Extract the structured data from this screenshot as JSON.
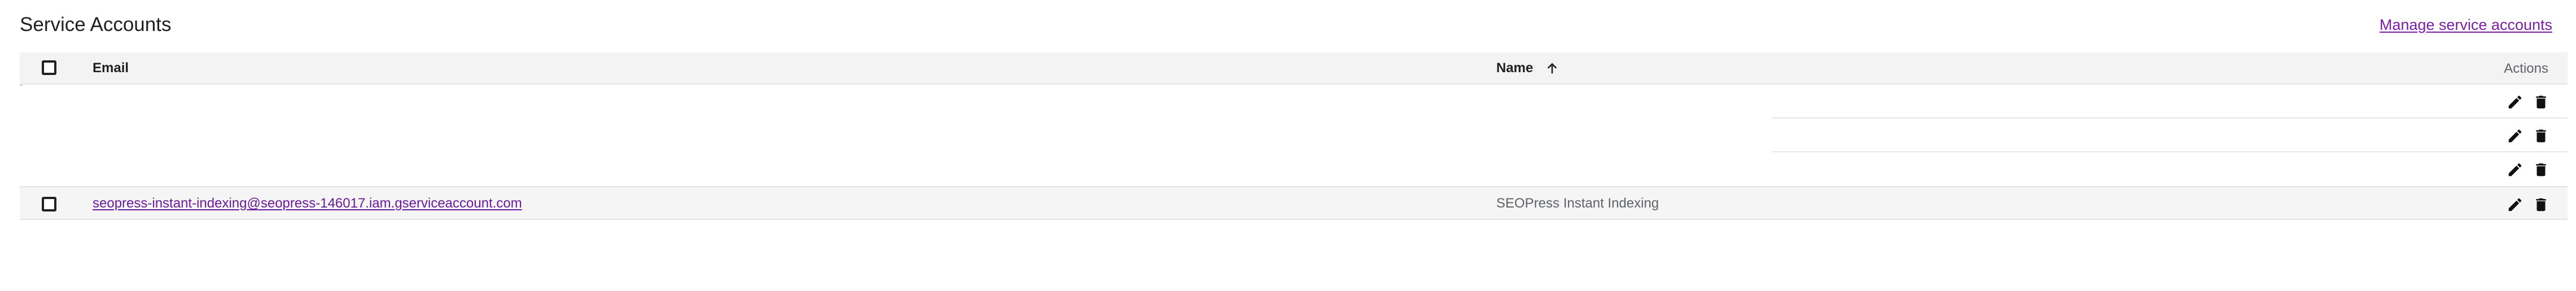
{
  "page": {
    "title": "Service Accounts",
    "manage_link": "Manage service accounts"
  },
  "table": {
    "columns": {
      "email": "Email",
      "name": "Name",
      "actions": "Actions"
    },
    "sort": {
      "column": "Name",
      "direction": "ascending",
      "icon": "arrow-up-icon"
    },
    "rows": [
      {
        "email": "",
        "name": ""
      },
      {
        "email": "",
        "name": ""
      },
      {
        "email": "",
        "name": ""
      },
      {
        "email": "seopress-instant-indexing@seopress-146017.iam.gserviceaccount.com",
        "name": "SEOPress Instant Indexing"
      }
    ],
    "row_actions": [
      "edit-icon",
      "delete-icon"
    ]
  },
  "colors": {
    "link": "#6a1b9a",
    "header_background": "#f3f3f3",
    "selected_row_background": "#f5f5f5",
    "text": "#202124",
    "muted_text": "#5f6368"
  }
}
